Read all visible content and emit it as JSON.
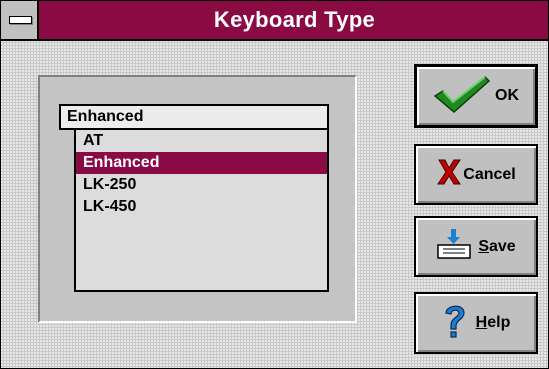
{
  "window": {
    "title": "Keyboard Type"
  },
  "combo": {
    "value": "Enhanced"
  },
  "list": {
    "items": [
      "AT",
      "Enhanced",
      "LK-250",
      "LK-450"
    ],
    "selected": "Enhanced"
  },
  "buttons": {
    "ok": {
      "label": "OK"
    },
    "cancel": {
      "label": "Cancel"
    },
    "save": {
      "mnemonic": "S",
      "rest": "ave"
    },
    "help": {
      "mnemonic": "H",
      "rest": "elp"
    }
  },
  "colors": {
    "titlebar": "#8a0a43",
    "selection": "#8a0a43",
    "check_green": "#1f8a1f",
    "cancel_red": "#c00000",
    "help_blue": "#1e7fd0"
  }
}
